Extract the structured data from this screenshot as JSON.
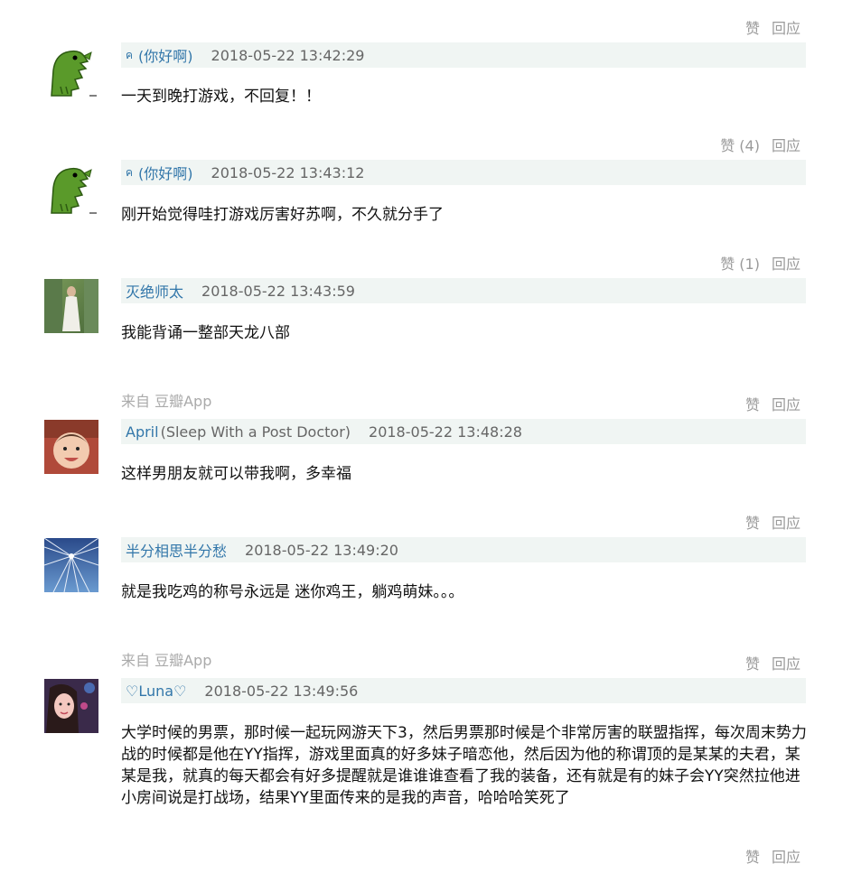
{
  "top_actions": {
    "like": "赞",
    "reply": "回应"
  },
  "comments": [
    {
      "author_icon": "ค",
      "author": "(你好啊)",
      "author_suffix": "",
      "time": "2018-05-22 13:42:29",
      "text": "一天到晚打游戏，不回复！！",
      "like": "赞 (4)",
      "reply": "回应",
      "source": ""
    },
    {
      "author_icon": "ค",
      "author": "(你好啊)",
      "author_suffix": "",
      "time": "2018-05-22 13:43:12",
      "text": "刚开始觉得哇打游戏厉害好苏啊，不久就分手了",
      "like": "赞 (1)",
      "reply": "回应",
      "source": ""
    },
    {
      "author_icon": "",
      "author": "灭绝师太",
      "author_suffix": "",
      "time": "2018-05-22 13:43:59",
      "text": "我能背诵一整部天龙八部",
      "like": "赞",
      "reply": "回应",
      "source": "来自 豆瓣App"
    },
    {
      "author_icon": "",
      "author": "April",
      "author_suffix": "(Sleep With a Post Doctor)",
      "time": "2018-05-22 13:48:28",
      "text": "这样男朋友就可以带我啊，多幸福",
      "like": "赞",
      "reply": "回应",
      "source": ""
    },
    {
      "author_icon": "",
      "author": "半分相思半分愁",
      "author_suffix": "",
      "time": "2018-05-22 13:49:20",
      "text": "就是我吃鸡的称号永远是 迷你鸡王，躺鸡萌妹。。。",
      "like": "赞",
      "reply": "回应",
      "source": "来自 豆瓣App"
    },
    {
      "author_icon": "",
      "author": "♡Luna♡",
      "author_suffix": "",
      "time": "2018-05-22 13:49:56",
      "text": "大学时候的男票，那时候一起玩网游天下3，然后男票那时候是个非常厉害的联盟指挥，每次周末势力战的时候都是他在YY指挥，游戏里面真的好多妹子暗恋他，然后因为他的称谓顶的是某某的夫君，某某是我，就真的每天都会有好多提醒就是谁谁谁查看了我的装备，还有就是有的妹子会YY突然拉他进小房间说是打战场，结果YY里面传来的是我的声音，哈哈哈笑死了",
      "like": "赞",
      "reply": "回应",
      "source": ""
    }
  ]
}
